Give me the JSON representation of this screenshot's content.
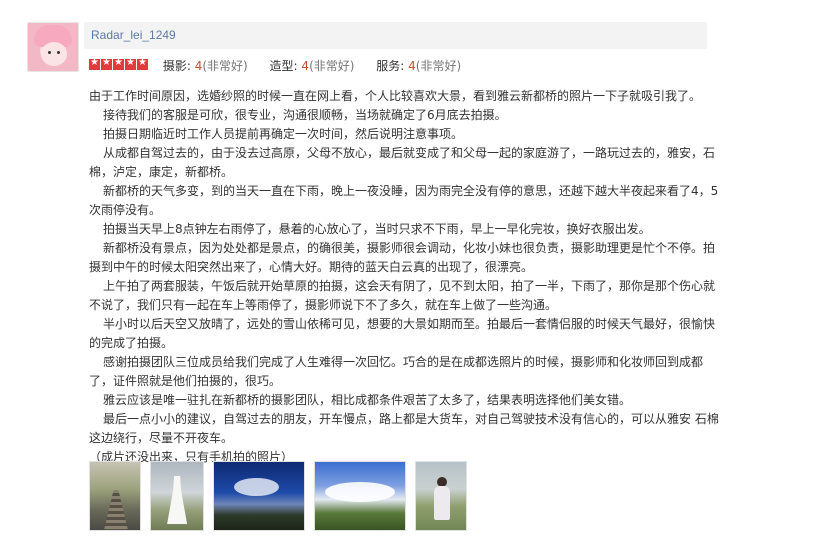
{
  "user": {
    "name": "Radar_lei_1249",
    "avatar_icon": "baby-avatar-icon"
  },
  "rating": {
    "stars": 5,
    "star_color": "#e4393c",
    "items": [
      {
        "label": "摄影:",
        "score": "4",
        "desc": "(非常好)"
      },
      {
        "label": "造型:",
        "score": "4",
        "desc": "(非常好)"
      },
      {
        "label": "服务:",
        "score": "4",
        "desc": "(非常好)"
      }
    ]
  },
  "review": {
    "paragraphs": [
      "由于工作时间原因，选婚纱照的时候一直在网上看，个人比较喜欢大景，看到雅云新都桥的照片一下子就吸引我了。",
      "接待我们的客服是可欣，很专业，沟通很顺畅，当场就确定了6月底去拍摄。",
      "拍摄日期临近时工作人员提前再确定一次时间，然后说明注意事项。",
      "从成都自驾过去的，由于没去过高原，父母不放心，最后就变成了和父母一起的家庭游了，一路玩过去的，雅安，石棉，泸定，康定，新都桥。",
      "新都桥的天气多变，到的当天一直在下雨，晚上一夜没睡，因为雨完全没有停的意思，还越下越大半夜起来看了4，5次雨停没有。",
      "拍摄当天早上8点钟左右雨停了，悬着的心放心了，当时只求不下雨，早上一早化完妆，换好衣服出发。",
      "新都桥没有景点，因为处处都是景点，的确很美，摄影师很会调动，化妆小妹也很负责，摄影助理更是忙个不停。拍摄到中午的时候太阳突然出来了，心情大好。期待的蓝天白云真的出现了，很漂亮。",
      "上午拍了两套服装，午饭后就开始草原的拍摄，这会天有阴了，见不到太阳，拍了一半，下雨了，那你是那个伤心就不说了，我们只有一起在车上等雨停了，摄影师说下不了多久，就在车上做了一些沟通。",
      "半小时以后天空又放晴了，远处的雪山依稀可见，想要的大景如期而至。拍最后一套情侣服的时候天气最好，很愉快的完成了拍摄。",
      "感谢拍摄团队三位成员给我们完成了人生难得一次回忆。巧合的是在成都选照片的时候，摄影师和化妆师回到成都了，证件照就是他们拍摄的，很巧。",
      "雅云应该是唯一驻扎在新都桥的摄影团队，相比成都条件艰苦了太多了，结果表明选择他们美女错。",
      "最后一点小小的建议，自驾过去的朋友，开车慢点，路上都是大货车，对自己驾驶技术没有信心的，可以从雅安 石棉这边绕行，尽量不开夜车。"
    ],
    "endnote": "（成片还没出来，只有手机拍的照片）"
  },
  "photos": [
    {
      "name": "photo-railway"
    },
    {
      "name": "photo-bride-dress"
    },
    {
      "name": "photo-blue-sky"
    },
    {
      "name": "photo-clouds-grassland"
    },
    {
      "name": "photo-couple-grassland"
    }
  ]
}
